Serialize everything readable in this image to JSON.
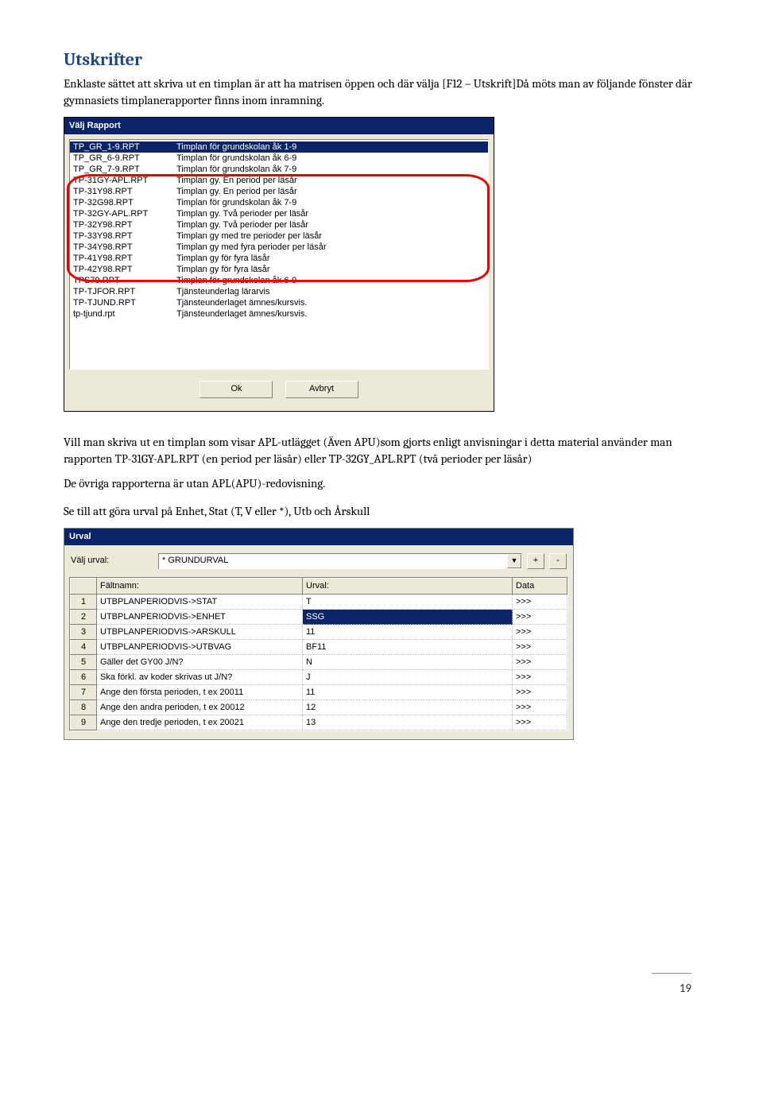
{
  "heading": "Utskrifter",
  "para1": "Enklaste sättet att skriva ut en timplan är att ha matrisen öppen och där välja [F12 – Utskrift]Då möts man av följande fönster där gymnasiets timplanerapporter finns inom inramning.",
  "reportDialog": {
    "title": "Välj Rapport",
    "rows": [
      {
        "file": "TP_GR_1-9.RPT",
        "desc": "Timplan för grundskolan åk 1-9"
      },
      {
        "file": "TP_GR_6-9.RPT",
        "desc": "Timplan för grundskolan åk 6-9"
      },
      {
        "file": "TP_GR_7-9.RPT",
        "desc": "Timplan för grundskolan åk 7-9"
      },
      {
        "file": "TP-31GY-APL.RPT",
        "desc": "Timplan gy. En period per läsår"
      },
      {
        "file": "TP-31Y98.RPT",
        "desc": "Timplan gy. En period per läsår"
      },
      {
        "file": "TP-32G98.RPT",
        "desc": "Timplan för grundskolan åk 7-9"
      },
      {
        "file": "TP-32GY-APL.RPT",
        "desc": "Timplan gy. Två perioder per läsår"
      },
      {
        "file": "TP-32Y98.RPT",
        "desc": "Timplan gy. Två perioder per läsår"
      },
      {
        "file": "TP-33Y98.RPT",
        "desc": "Timplan gy med tre perioder per läsår"
      },
      {
        "file": "TP-34Y98.RPT",
        "desc": "Timplan gy med fyra perioder per läsår"
      },
      {
        "file": "TP-41Y98.RPT",
        "desc": "Timplan gy för fyra läsår"
      },
      {
        "file": "TP-42Y98.RPT",
        "desc": "Timplan gy för fyra läsår"
      },
      {
        "file": "TPS79.RPT",
        "desc": "Timplan för grundskolan åk 6-9"
      },
      {
        "file": "TP-TJFOR.RPT",
        "desc": "Tjänsteunderlag lärarvis"
      },
      {
        "file": "TP-TJUND.RPT",
        "desc": "Tjänsteunderlaget ämnes/kursvis."
      },
      {
        "file": "tp-tjund.rpt",
        "desc": "Tjänsteunderlaget ämnes/kursvis."
      }
    ],
    "okLabel": "Ok",
    "cancelLabel": "Avbryt"
  },
  "para2": "Vill man skriva ut en timplan som visar APL-utlägget (Även APU)som gjorts enligt anvisningar i detta material använder man rapporten TP-31GY-APL.RPT (en period per läsår) eller TP-32GY_APL.RPT (två perioder per läsår)",
  "para3": "De övriga rapporterna är utan APL(APU)-redovisning.",
  "para4": "Se till att göra urval på Enhet, Stat (T, V eller *), Utb och Årskull",
  "urvalDialog": {
    "title": "Urval",
    "selectLabel": "Välj urval:",
    "selectedUrval": "* GRUNDURVAL",
    "plus": "+",
    "minus": "-",
    "headers": {
      "n": "",
      "field": "Fältnamn:",
      "urval": "Urval:",
      "data": "Data"
    },
    "rows": [
      {
        "n": "1",
        "field": "UTBPLANPERIODVIS->STAT",
        "urval": "T",
        "data": ">>>"
      },
      {
        "n": "2",
        "field": "UTBPLANPERIODVIS->ENHET",
        "urval": "SSG",
        "data": ">>>",
        "selected": true
      },
      {
        "n": "3",
        "field": "UTBPLANPERIODVIS->ARSKULL",
        "urval": "11",
        "data": ">>>"
      },
      {
        "n": "4",
        "field": "UTBPLANPERIODVIS->UTBVAG",
        "urval": "BF11",
        "data": ">>>"
      },
      {
        "n": "5",
        "field": "Gäller det GY00 J/N?",
        "urval": "N",
        "data": ">>>"
      },
      {
        "n": "6",
        "field": "Ska förkl. av koder skrivas ut J/N?",
        "urval": "J",
        "data": ">>>"
      },
      {
        "n": "7",
        "field": "Ange den första perioden, t ex 20011",
        "urval": "11",
        "data": ">>>"
      },
      {
        "n": "8",
        "field": "Ange den andra perioden, t ex 20012",
        "urval": "12",
        "data": ">>>"
      },
      {
        "n": "9",
        "field": "Ange den tredje perioden, t ex 20021",
        "urval": "13",
        "data": ">>>"
      }
    ]
  },
  "pageNumber": "19"
}
